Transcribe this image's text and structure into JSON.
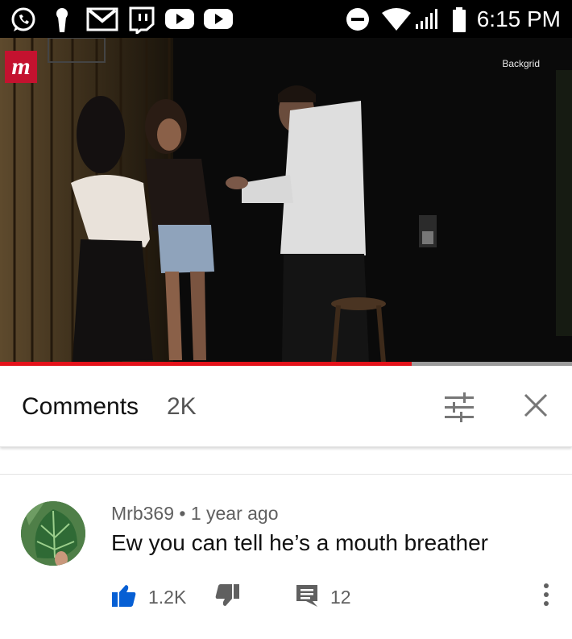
{
  "status_bar": {
    "time": "6:15 PM",
    "left_icons": [
      "whatsapp-icon",
      "keyhole-icon",
      "gmail-icon",
      "twitch-icon",
      "youtube-icon",
      "youtube-icon"
    ],
    "right_icons": [
      "do-not-disturb-icon",
      "wifi-icon",
      "signal-icon",
      "battery-icon"
    ]
  },
  "video": {
    "logo_letter": "m",
    "credit": "Backgrid",
    "progress_fraction": 0.72,
    "colors": {
      "progress": "#e4121a",
      "logo_bg": "#c4122f"
    }
  },
  "comments_header": {
    "title": "Comments",
    "count": "2K"
  },
  "comment": {
    "author": "Mrb369",
    "separator": " • ",
    "time_ago": "1 year ago",
    "text": "Ew you can tell he’s a mouth breather",
    "likes": "1.2K",
    "replies": "12",
    "like_color": "#065fd4"
  }
}
